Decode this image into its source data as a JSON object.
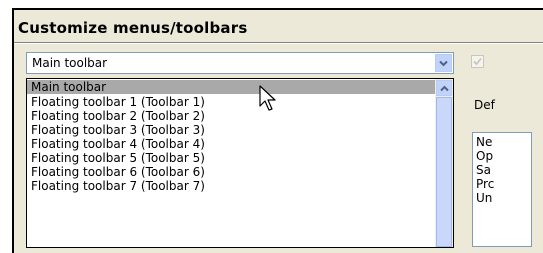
{
  "window": {
    "title": "Customize menus/toolbars"
  },
  "combo": {
    "selected": "Main toolbar"
  },
  "dropdown": {
    "options": [
      "Main toolbar",
      "Floating toolbar 1 (Toolbar 1)",
      "Floating toolbar 2 (Toolbar 2)",
      "Floating toolbar 3 (Toolbar 3)",
      "Floating toolbar 4 (Toolbar 4)",
      "Floating toolbar 5 (Toolbar 5)",
      "Floating toolbar 6 (Toolbar 6)",
      "Floating toolbar 7 (Toolbar 7)"
    ],
    "highlighted_index": 0
  },
  "right_panel": {
    "checkbox_checked": true,
    "label": "Def",
    "list_items": [
      "Ne",
      "Op",
      "Sa",
      "Prc",
      "Un"
    ]
  },
  "icons": {
    "combo_button": "chevron-down-icon",
    "scroll_up": "chevron-up-icon",
    "cursor": "mouse-pointer-icon",
    "check": "checkmark-icon"
  },
  "colors": {
    "highlight": "#a9a9a9",
    "scroll_accent": "#c1d3fb",
    "dialog_bg": "#ece9d8"
  }
}
